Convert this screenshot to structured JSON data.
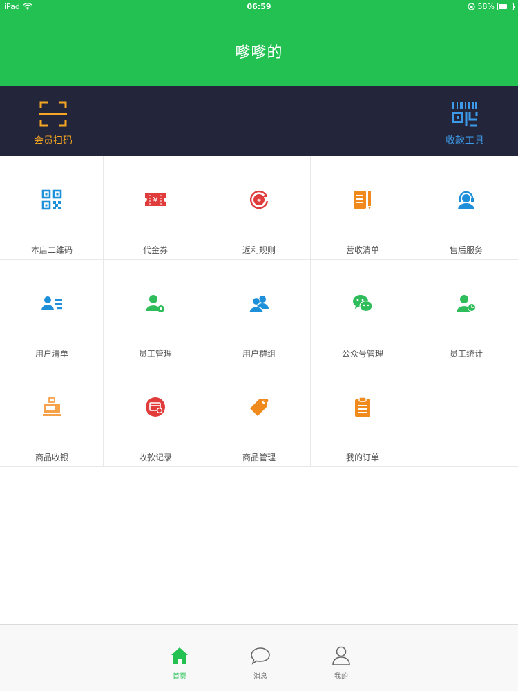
{
  "status_bar": {
    "device": "iPad",
    "time": "06:59",
    "battery": "58%",
    "battery_level": 0.58
  },
  "header": {
    "title": "嗲嗲的"
  },
  "actions": {
    "scan": {
      "label": "会员扫码",
      "icon": "scan-frame-icon"
    },
    "pay": {
      "label": "收款工具",
      "icon": "barcode-icon"
    }
  },
  "grid": {
    "items": [
      {
        "label": "本店二维码",
        "icon": "qr-code-icon"
      },
      {
        "label": "代金券",
        "icon": "voucher-icon"
      },
      {
        "label": "返利规则",
        "icon": "rebate-icon"
      },
      {
        "label": "营收清单",
        "icon": "revenue-list-icon"
      },
      {
        "label": "售后服务",
        "icon": "customer-service-icon"
      },
      {
        "label": "用户清单",
        "icon": "user-list-icon"
      },
      {
        "label": "员工管理",
        "icon": "staff-management-icon"
      },
      {
        "label": "用户群组",
        "icon": "user-group-icon"
      },
      {
        "label": "公众号管理",
        "icon": "wechat-icon"
      },
      {
        "label": "员工统计",
        "icon": "staff-stats-icon"
      },
      {
        "label": "商品收银",
        "icon": "cash-register-icon"
      },
      {
        "label": "收款记录",
        "icon": "payment-record-icon"
      },
      {
        "label": "商品管理",
        "icon": "price-tag-icon"
      },
      {
        "label": "我的订单",
        "icon": "clipboard-icon"
      }
    ]
  },
  "tabs": [
    {
      "label": "首页",
      "icon": "home-icon",
      "active": true
    },
    {
      "label": "消息",
      "icon": "chat-bubble-icon",
      "active": false
    },
    {
      "label": "我的",
      "icon": "person-icon",
      "active": false
    }
  ],
  "colors": {
    "header_green": "#22c152",
    "action_bar": "#23263a",
    "scan_orange": "#f5a623",
    "pay_blue": "#3d9ae8",
    "blue": "#1e8fd9",
    "red": "#e03c3c",
    "orange": "#f08a1c",
    "green": "#2ebd5a"
  }
}
